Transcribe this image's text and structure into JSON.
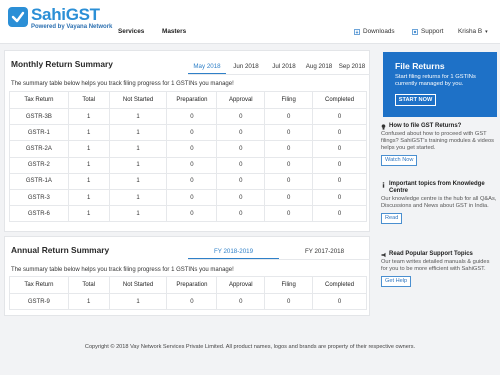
{
  "brand": {
    "name": "SahiGST",
    "tagline": "Powered by Vayana Network"
  },
  "nav": {
    "services": "Services",
    "masters": "Masters"
  },
  "utility": {
    "downloads": "Downloads",
    "support": "Support",
    "user": "Krisha B"
  },
  "monthly": {
    "title": "Monthly Return Summary",
    "tabs": [
      "May 2018",
      "Jun 2018",
      "Jul 2018",
      "Aug 2018",
      "Sep 2018"
    ],
    "active_tab": "May 2018",
    "description": "The summary table below helps you track filing progress for 1 GSTINs you manage!",
    "columns": [
      "Tax Return",
      "Total",
      "Not Started",
      "Preparation",
      "Approval",
      "Filing",
      "Completed"
    ],
    "rows": [
      [
        "GSTR-3B",
        "1",
        "1",
        "0",
        "0",
        "0",
        "0"
      ],
      [
        "GSTR-1",
        "1",
        "1",
        "0",
        "0",
        "0",
        "0"
      ],
      [
        "GSTR-2A",
        "1",
        "1",
        "0",
        "0",
        "0",
        "0"
      ],
      [
        "GSTR-2",
        "1",
        "1",
        "0",
        "0",
        "0",
        "0"
      ],
      [
        "GSTR-1A",
        "1",
        "1",
        "0",
        "0",
        "0",
        "0"
      ],
      [
        "GSTR-3",
        "1",
        "1",
        "0",
        "0",
        "0",
        "0"
      ],
      [
        "GSTR-6",
        "1",
        "1",
        "0",
        "0",
        "0",
        "0"
      ]
    ]
  },
  "annual": {
    "title": "Annual Return Summary",
    "tabs": [
      "FY 2018-2019",
      "FY 2017-2018"
    ],
    "active_tab": "FY 2018-2019",
    "description": "The summary table below helps you track filing progress for 1 GSTINs you manage!",
    "columns": [
      "Tax Return",
      "Total",
      "Not Started",
      "Preparation",
      "Approval",
      "Filing",
      "Completed"
    ],
    "rows": [
      [
        "GSTR-9",
        "1",
        "1",
        "0",
        "0",
        "0",
        "0"
      ]
    ]
  },
  "promo": {
    "title": "File Returns",
    "text": "Start filing returns for 1 GSTINs currently managed by you.",
    "button": "START NOW"
  },
  "help": [
    {
      "title": "How to file GST Returns?",
      "text": "Confused about how to proceed with GST filings? SahiGST's training modules & videos helps you get started.",
      "button": "Watch Now",
      "icon": "lightbulb-icon"
    },
    {
      "title": "Important topics from Knowledge Centre",
      "text": "Our knowledge centre is the hub for all Q&As, Discussions and News about GST in India.",
      "button": "Read",
      "icon": "info-icon"
    },
    {
      "title": "Read Popular Support Topics",
      "text": "Our team writes detailed manuals & guides for you to be more efficient with SahiGST.",
      "button": "Get Help",
      "icon": "megaphone-icon"
    }
  ],
  "footer": "Copyright © 2018 Vay Network Services Private Limited. All product names, logos and brands are property of their respective owners.",
  "colors": {
    "brand_blue": "#2b8fd6",
    "promo_blue": "#1e71c7",
    "tab_active": "#2f80c8"
  }
}
